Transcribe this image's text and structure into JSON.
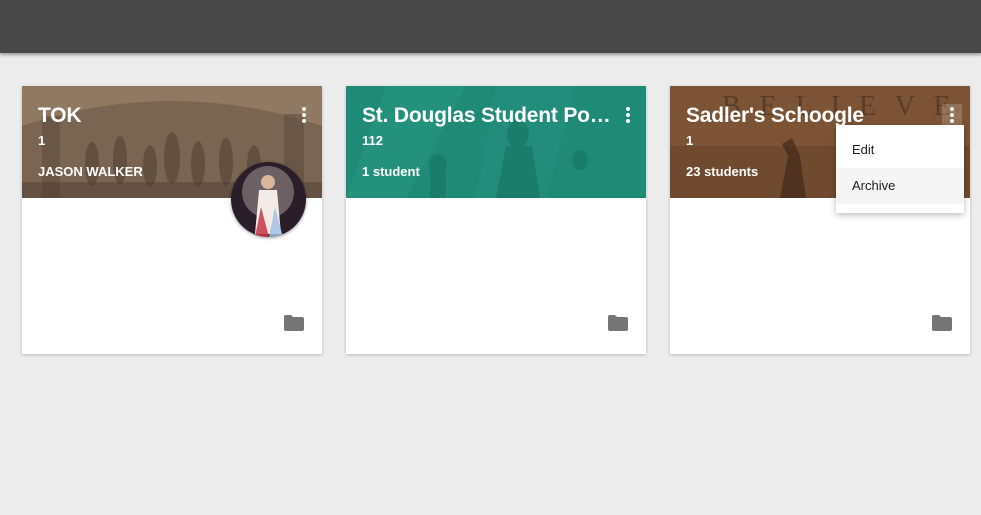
{
  "header": {},
  "classes": [
    {
      "title": "TOK",
      "section": "1",
      "subtitle": "JASON WALKER",
      "theme_color": "#6b5648",
      "has_avatar": true
    },
    {
      "title": "St. Douglas Student Portfolio",
      "section": "112",
      "subtitle": "1 student",
      "theme_color": "#1f8a76",
      "has_avatar": false
    },
    {
      "title": "Sadler's Schoogle",
      "section": "1",
      "subtitle": "23 students",
      "theme_color": "#6f4a2e",
      "banner_text": "B E L I E V E",
      "has_avatar": false
    }
  ],
  "menu": {
    "items": [
      "Edit",
      "Archive"
    ],
    "highlighted": "Archive"
  },
  "icons": {
    "more": "more-vert-icon",
    "folder": "folder-icon"
  }
}
